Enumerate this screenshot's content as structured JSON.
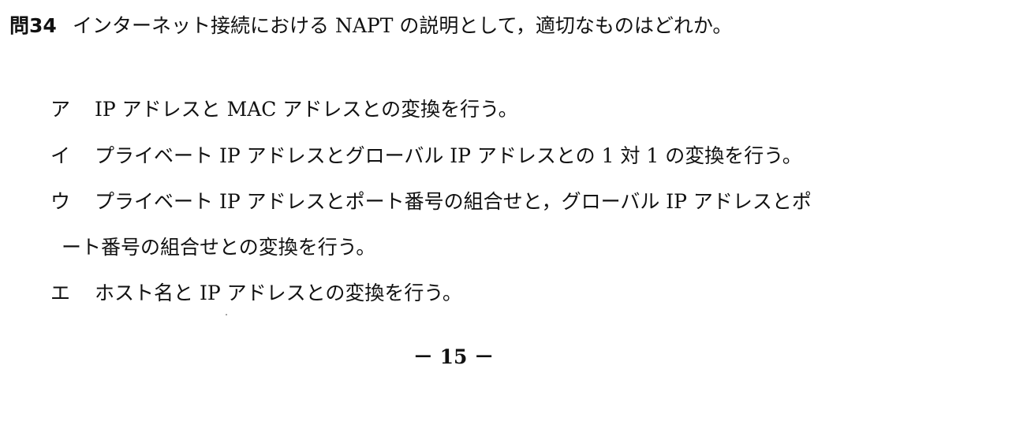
{
  "question": {
    "number": "問34",
    "text": "インターネット接続における NAPT の説明として，適切なものはどれか。"
  },
  "choices": [
    {
      "label": "ア",
      "text": "IP アドレスと MAC アドレスとの変換を行う。"
    },
    {
      "label": "イ",
      "text": "プライベート IP アドレスとグローバル IP アドレスとの 1 対 1 の変換を行う。"
    },
    {
      "label": "ウ",
      "text": "プライベート IP アドレスとポート番号の組合せと，グローバル IP アドレスとポ",
      "continuation": "ート番号の組合せとの変換を行う。"
    },
    {
      "label": "エ",
      "text": "ホスト名と IP アドレスとの変換を行う。"
    }
  ],
  "page_number": "－ 15 －"
}
